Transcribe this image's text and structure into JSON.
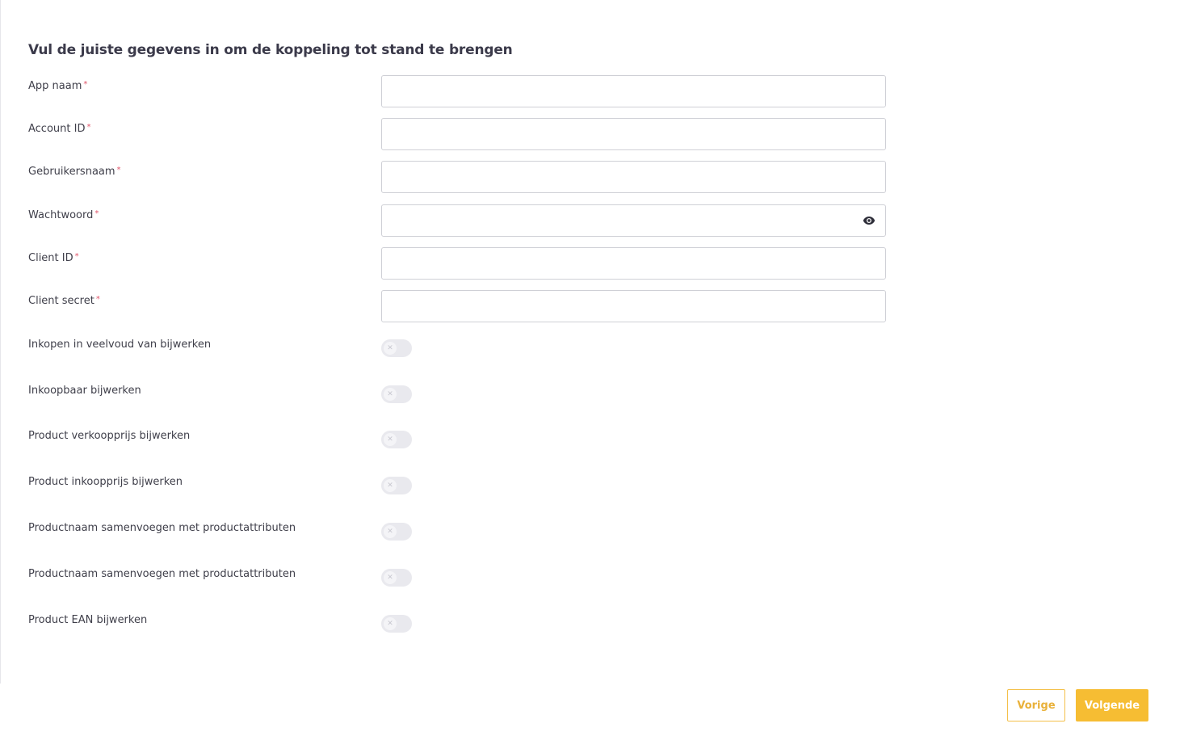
{
  "form": {
    "title": "Vul de juiste gegevens in om de koppeling tot stand te brengen",
    "required_marker": "*",
    "fields": [
      {
        "label": "App naam",
        "value": "",
        "required": true
      },
      {
        "label": "Account ID",
        "value": "",
        "required": true
      },
      {
        "label": "Gebruikersnaam",
        "value": "",
        "required": true
      },
      {
        "label": "Wachtwoord",
        "value": "",
        "required": true,
        "icon": "eye-icon"
      },
      {
        "label": "Client ID",
        "value": "",
        "required": true
      },
      {
        "label": "Client secret",
        "value": "",
        "required": true
      }
    ],
    "toggles": [
      {
        "label": "Inkopen in veelvoud van bijwerken",
        "on": false
      },
      {
        "label": "Inkoopbaar bijwerken",
        "on": false
      },
      {
        "label": "Product verkoopprijs bijwerken",
        "on": false
      },
      {
        "label": "Product inkoopprijs bijwerken",
        "on": false
      },
      {
        "label": "Productnaam samenvoegen met productattributen",
        "on": false
      },
      {
        "label": "Productnaam samenvoegen met productattributen",
        "on": false
      },
      {
        "label": "Product EAN bijwerken",
        "on": false
      }
    ],
    "toggle_off_glyph": "✕"
  },
  "footer": {
    "prev_label": "Vorige",
    "next_label": "Volgende"
  },
  "colors": {
    "accent": "#f6bd33",
    "required": "#e0556a",
    "text": "#3b3a4a"
  }
}
